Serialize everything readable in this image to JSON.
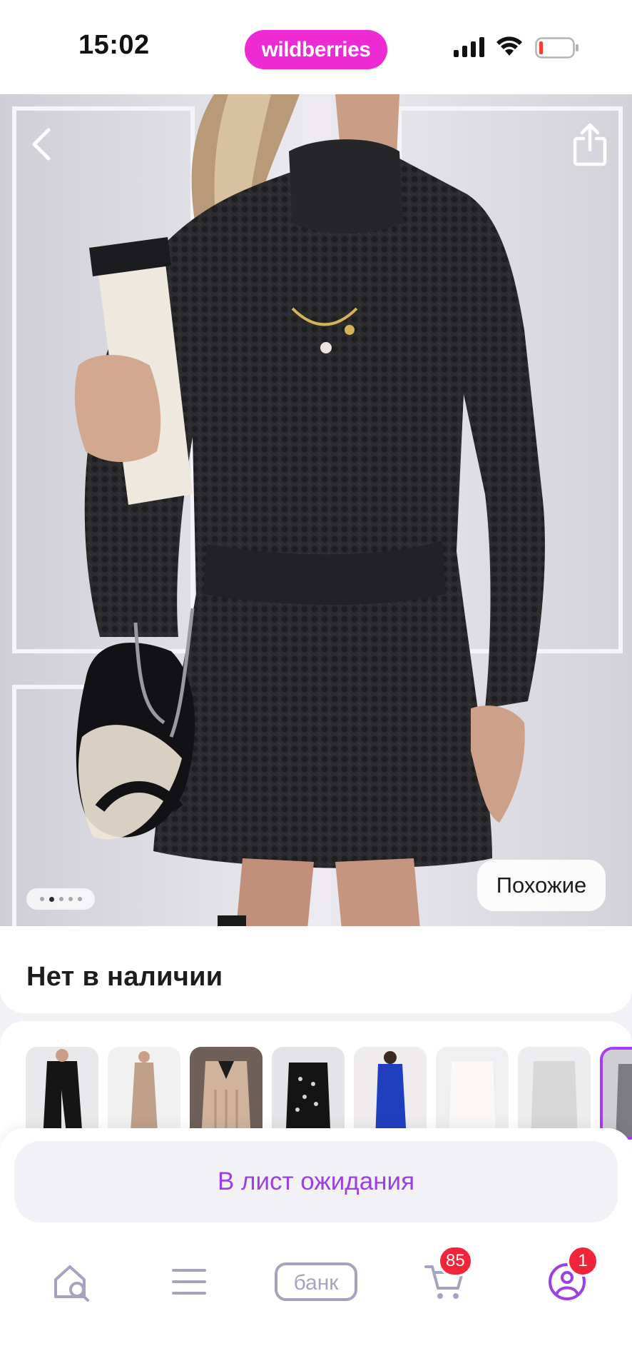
{
  "status_bar": {
    "time": "15:02",
    "brand": "wildberries",
    "brand_color": "#ee2bd3",
    "icons": [
      "cellular-signal-icon",
      "wifi-icon",
      "battery-low-icon"
    ]
  },
  "product": {
    "image_alt": "Черное вязаное платье-свитер с высоким горлом",
    "gallery_dots": 5,
    "active_dot": 2,
    "similar_label": "Похожие",
    "availability": "Нет в наличии"
  },
  "navigation": {
    "back_icon": "chevron-left-icon",
    "share_icon": "share-icon"
  },
  "similar_items": [
    {
      "name": "black-dress-slit"
    },
    {
      "name": "beige-fitted-dress"
    },
    {
      "name": "beige-cable-knit-dress"
    },
    {
      "name": "black-dotted-dress"
    },
    {
      "name": "blue-dress"
    },
    {
      "name": "white-sweater-dress"
    },
    {
      "name": "grey-sweater-dress"
    },
    {
      "name": "current-item"
    }
  ],
  "actions": {
    "waitlist_label": "В лист ожидания",
    "accent_color": "#9b3fe9"
  },
  "tabbar": {
    "items": [
      {
        "name": "home-search",
        "icon": "home-search-icon"
      },
      {
        "name": "catalog",
        "icon": "menu-icon"
      },
      {
        "name": "bank",
        "label": "банк"
      },
      {
        "name": "cart",
        "icon": "cart-icon",
        "badge": "85"
      },
      {
        "name": "profile",
        "icon": "profile-icon",
        "badge": "1"
      }
    ]
  }
}
